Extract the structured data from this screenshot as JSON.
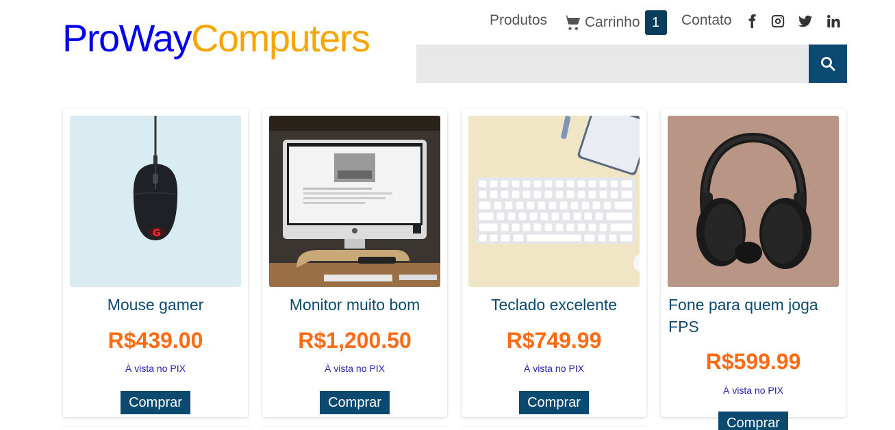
{
  "header": {
    "logo_part1": "ProWay",
    "logo_part2": "Computers",
    "nav": {
      "produtos": "Produtos",
      "carrinho": "Carrinho",
      "cart_count": "1",
      "contato": "Contato"
    },
    "social_icons": [
      "facebook-icon",
      "instagram-icon",
      "twitter-icon",
      "linkedin-icon"
    ],
    "search": {
      "placeholder": "",
      "value": ""
    }
  },
  "products": [
    {
      "name": "Mouse gamer",
      "price": "R$439.00",
      "payment": "À vista no PIX",
      "button": "Comprar",
      "image": "mouse-image"
    },
    {
      "name": "Monitor muito bom",
      "price": "R$1,200.50",
      "payment": "À vista no PIX",
      "button": "Comprar",
      "image": "monitor-image"
    },
    {
      "name": "Teclado excelente",
      "price": "R$749.99",
      "payment": "À vista no PIX",
      "button": "Comprar",
      "image": "keyboard-image"
    },
    {
      "name": "Fone para quem joga FPS",
      "price": "R$599.99",
      "payment": "À vista no PIX",
      "button": "Comprar",
      "image": "headphones-image"
    }
  ],
  "colors": {
    "logo_blue": "#0000ee",
    "logo_orange": "#f7a500",
    "primary": "#0a4a70",
    "price": "#ff6a13",
    "product_name": "#0b4a6f"
  }
}
